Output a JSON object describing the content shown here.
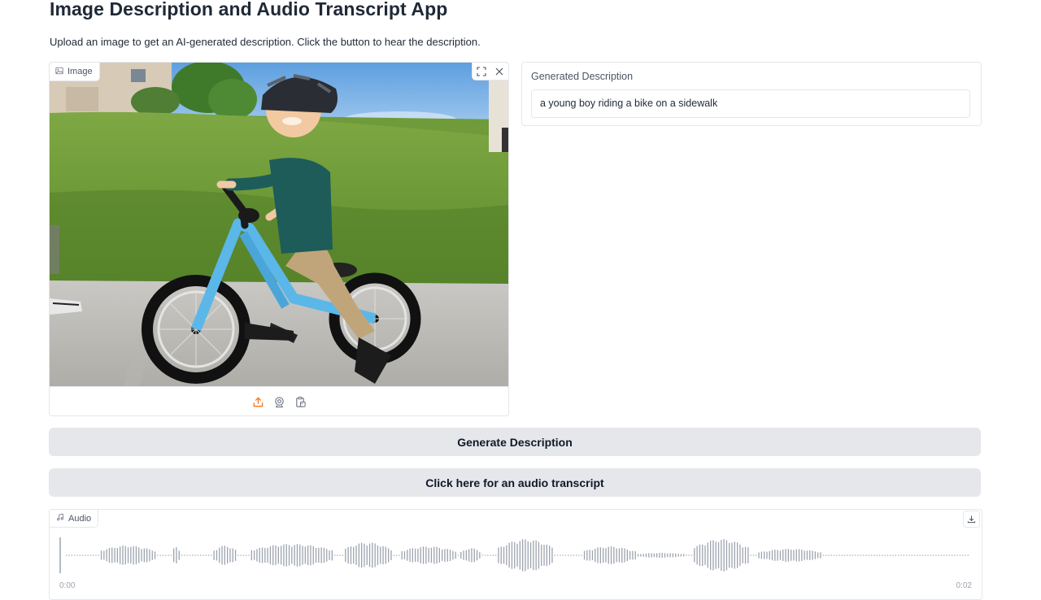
{
  "page": {
    "title": "Image Description and Audio Transcript App",
    "subtitle": "Upload an image to get an AI-generated description. Click the button to hear the description."
  },
  "image_block": {
    "label": "Image",
    "label_icon": "image-icon",
    "actions": [
      "fullscreen-icon",
      "close-icon"
    ],
    "sources": [
      "upload-icon",
      "webcam-icon",
      "clipboard-icon"
    ]
  },
  "description_block": {
    "label": "Generated Description",
    "value": "a young boy riding a bike on a sidewalk"
  },
  "buttons": {
    "generate": "Generate Description",
    "audio": "Click here for an audio transcript"
  },
  "audio_block": {
    "label": "Audio",
    "label_icon": "music-icon",
    "download_icon": "download-icon",
    "time_start": "0:00",
    "time_end": "0:02"
  },
  "colors": {
    "accent": "#f97316",
    "button_bg": "#e5e7eb",
    "waveform": "#9ca3af",
    "border": "#e5e7eb"
  }
}
